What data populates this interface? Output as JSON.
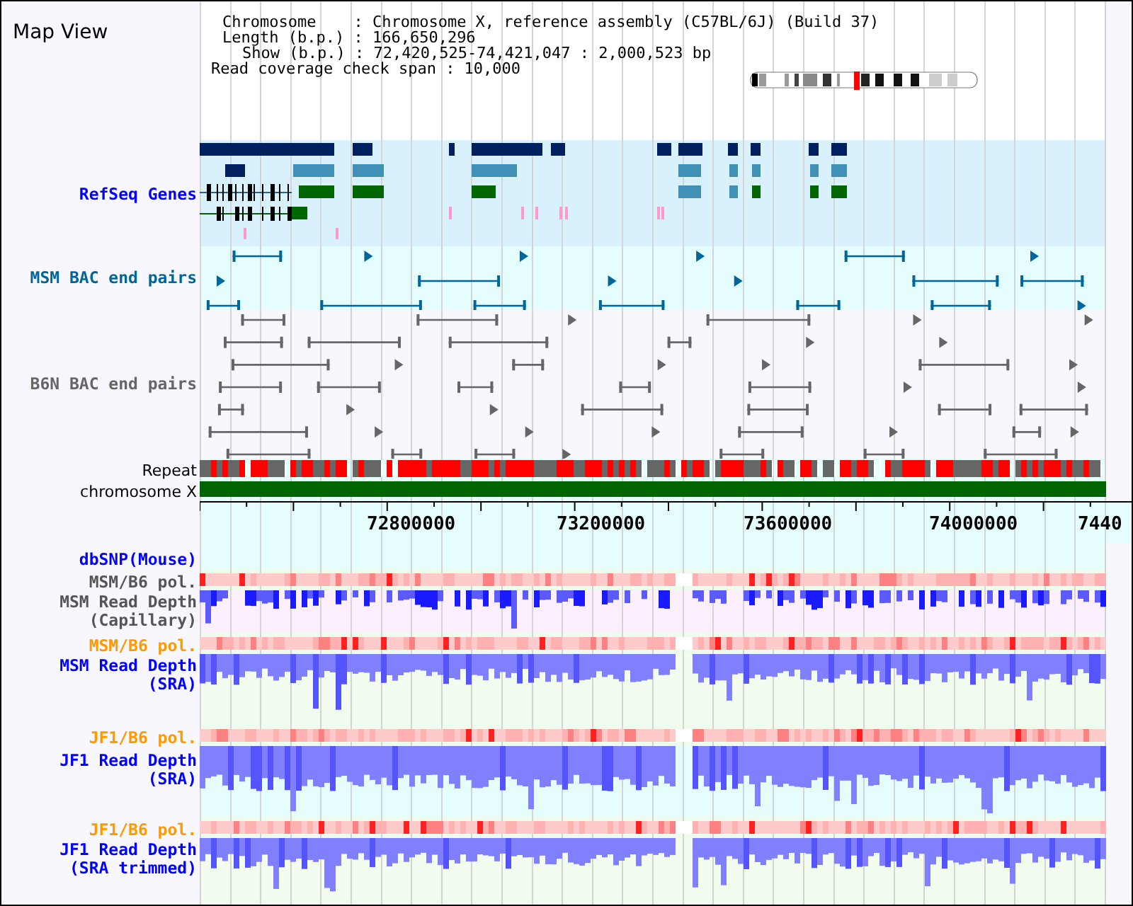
{
  "title": "Map View",
  "info": [
    "Chromosome    : Chromosome X, reference assembly (C57BL/6J) (Build 37)",
    "Length (b.p.) : 166,650,296",
    "Show (b.p.) : 72,420,525-74,421,047 : 2,000,523 bp",
    "Read coverage check span : 10,000"
  ],
  "tracks_top": [
    {
      "label": "RefSeq Genes",
      "kind": "genes",
      "color": "#0000ff"
    },
    {
      "label": "MSM BAC end pairs",
      "kind": "bac",
      "color": "#006699"
    },
    {
      "label": "B6N BAC end pairs",
      "kind": "bac6",
      "color": "#666666"
    },
    {
      "label": "Repeat",
      "kind": "repeat",
      "color": "#000000"
    },
    {
      "label": "chromosome X",
      "kind": "chrom",
      "color": "#000000"
    }
  ],
  "axis": {
    "labels": [
      "72800000",
      "73200000",
      "73600000",
      "74000000",
      "7440"
    ]
  },
  "tracks_bottom": [
    {
      "label": "dbSNP(Mouse)",
      "kind": "snp",
      "color": "#0000ff"
    },
    {
      "label": "MSM/B6 pol.",
      "kind": "pol",
      "color": "#555555"
    },
    {
      "label": "MSM Read Depth (Capillary)",
      "kind": "cap",
      "color": "#555555"
    },
    {
      "label": "MSM/B6 pol.",
      "kind": "pol",
      "color": "#ff9900"
    },
    {
      "label": "MSM Read Depth (SRA)",
      "kind": "depth",
      "color": "#0000ff"
    },
    {
      "label": "JF1/B6 pol.",
      "kind": "pol",
      "color": "#ff9900"
    },
    {
      "label": "JF1 Read Depth (SRA)",
      "kind": "depth2",
      "color": "#0000ff"
    },
    {
      "label": "JF1/B6 pol.",
      "kind": "pol",
      "color": "#ff9900"
    },
    {
      "label": "JF1 Read Depth (SRA trimmed)",
      "kind": "depth",
      "color": "#0000ff"
    }
  ]
}
